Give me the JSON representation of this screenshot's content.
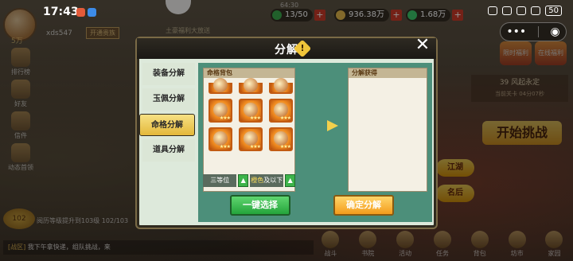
{
  "status_bar": {
    "time": "17:43",
    "battery": "50"
  },
  "hud": {
    "player_name": "xds547",
    "vip": "开通贵族",
    "power": "5万",
    "stamina_top": "64:30",
    "stamina": "13/50",
    "silver": "936.38万",
    "jade": "1.68万",
    "activity_sub": "土豪福利大放送"
  },
  "side_menu": [
    "排行榜",
    "好友",
    "信件",
    "动态首领"
  ],
  "left_bottom": {
    "level_badge": "102",
    "hint": "阅历等级提升到103级 102/103"
  },
  "chat": {
    "channel": "[战区]",
    "text": "我下午拿快递，组队挑战，来"
  },
  "right": {
    "tags": [
      "限时福利",
      "在线福利"
    ],
    "stage_title": "39 风起永定",
    "stage_sub": "当前关卡 04分07秒",
    "start_label": "开始挑战",
    "btn1": "江湖",
    "btn2": "名后"
  },
  "bottom_nav": [
    "战斗",
    "书院",
    "活动",
    "任务",
    "背包",
    "坊市",
    "家园"
  ],
  "dialog": {
    "title": "分解",
    "help_icon": "!",
    "close": "✕",
    "tabs": [
      "装备分解",
      "玉佩分解",
      "命格分解",
      "道具分解"
    ],
    "active_tab": 2,
    "bag_header": "命格背包",
    "result_header": "分解获得",
    "filter_quality": "三等位",
    "filter_level_hl": "橙色",
    "filter_level": "及以下",
    "btn_select": "一键选择",
    "btn_confirm": "确定分解",
    "item_count": 9
  },
  "colors": {
    "accent_orange": "#f39c1c",
    "accent_green": "#24a43b",
    "panel_bg": "#4c8f7a"
  }
}
